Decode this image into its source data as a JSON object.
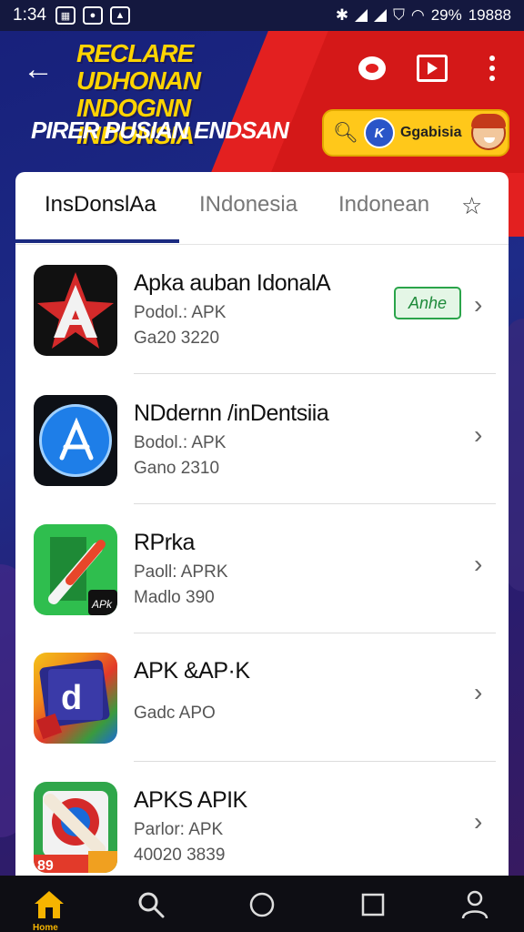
{
  "status_bar": {
    "time": "1:34",
    "battery_text": "29%",
    "clock_right": "19888"
  },
  "header": {
    "banner_title": "RECLARE UDHONAN INDOGNN INDONSIA",
    "banner_subtitle": "PIRER PUSIAN ENDSAN",
    "search_pill_text": "Ggabisia",
    "search_pill_badge": "K"
  },
  "tabs": [
    {
      "label": "InsDonslAa",
      "active": true
    },
    {
      "label": "INdonesia",
      "active": false
    },
    {
      "label": "Indonean",
      "active": false
    }
  ],
  "apps": [
    {
      "title": "Apka auban IdonalA",
      "line2": "Podol.: APK",
      "line3": "Ga20 3220",
      "button": "Anhe",
      "icon": "red-a-star-icon"
    },
    {
      "title": "NDdernn /inDentsiia",
      "line2": "Bodol.: APK",
      "line3": "Gano 2310",
      "icon": "app-store-a-icon"
    },
    {
      "title": "RPrka",
      "line2": "Paoll: APRK",
      "line3": "Madlo 390",
      "icon": "paint-brush-icon"
    },
    {
      "title": "APK &AP·K",
      "line2": "Gadc APO",
      "icon": "letter-d-icon"
    },
    {
      "title": "APKS APIK",
      "line2": "Parlor: APK",
      "line3": "40020 3839",
      "icon": "pencil-tile-icon"
    }
  ],
  "bottom_nav": {
    "home_label": "Home"
  },
  "colors": {
    "brand_blue": "#1e2a88",
    "brand_red": "#e32020",
    "accent_yellow": "#ffd400",
    "button_green": "#2aa44a"
  }
}
